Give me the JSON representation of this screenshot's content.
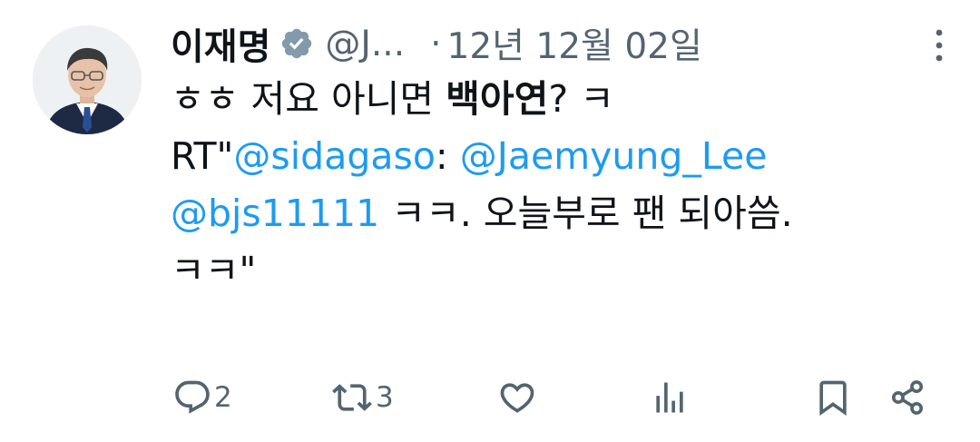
{
  "user": {
    "display_name": "이재명",
    "handle": "@J...",
    "separator": "·",
    "timestamp": "12년 12월 02일"
  },
  "body": {
    "line1_pre": "ㅎㅎ 저요 아니면 ",
    "line1_bold": "백아연",
    "line1_post": "? ㅋ",
    "line2_pre": "RT\"",
    "line2_mention1": "@sidagaso",
    "line2_mid": ": ",
    "line2_mention2": "@Jaemyung_Lee",
    "line3_mention": "@bjs11111",
    "line3_post": " ㅋㅋ. 오늘부로 팬 되아씀.",
    "line4": "ㅋㅋ\""
  },
  "actions": {
    "reply_count": "2",
    "retweet_count": "3"
  },
  "icons": {
    "verified": "verified-badge-icon",
    "more": "more-options-icon",
    "reply": "reply-icon",
    "retweet": "retweet-icon",
    "like": "heart-icon",
    "views": "views-icon",
    "bookmark": "bookmark-icon",
    "share": "share-icon"
  },
  "colors": {
    "text": "#0f1419",
    "secondary": "#536471",
    "link": "#1d9bf0",
    "badge": "#829aab"
  }
}
